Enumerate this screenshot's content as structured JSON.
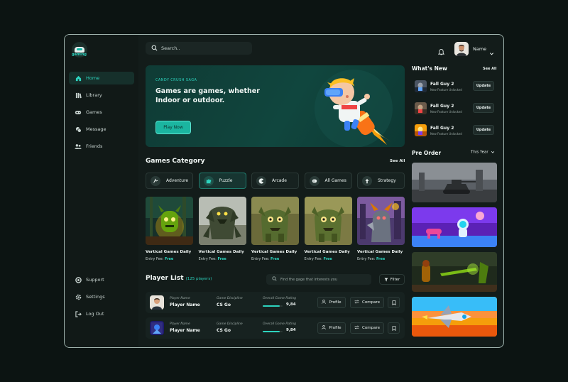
{
  "brand": {
    "name": "gaming"
  },
  "sidebar": {
    "items": [
      {
        "label": "Home",
        "icon": "home-icon",
        "active": true
      },
      {
        "label": "Library",
        "icon": "library-icon"
      },
      {
        "label": "Games",
        "icon": "gamepad-icon"
      },
      {
        "label": "Message",
        "icon": "message-icon"
      },
      {
        "label": "Friends",
        "icon": "friends-icon"
      }
    ],
    "bottom": [
      {
        "label": "Support",
        "icon": "support-icon"
      },
      {
        "label": "Settings",
        "icon": "gear-icon"
      },
      {
        "label": "Log Out",
        "icon": "logout-icon"
      }
    ]
  },
  "header": {
    "search_placeholder": "Search..",
    "user_name": "Name"
  },
  "hero": {
    "eyebrow": "CANDY CRUSH SAGA",
    "title": "Games are games, whether Indoor or outdoor.",
    "button": "Play Now"
  },
  "categories": {
    "title": "Games Category",
    "see_all": "See All",
    "items": [
      {
        "label": "Adventure",
        "icon": "adventure-icon"
      },
      {
        "label": "Puzzle",
        "icon": "puzzle-icon",
        "active": true
      },
      {
        "label": "Arcade",
        "icon": "arcade-icon"
      },
      {
        "label": "All Games",
        "icon": "all-games-icon"
      },
      {
        "label": "Strategy",
        "icon": "strategy-icon"
      }
    ]
  },
  "games": {
    "fee_label": "Entry Fee:",
    "fee_value": "Free",
    "items": [
      {
        "name": "Vertical Games Daily"
      },
      {
        "name": "Vertical Games Daily"
      },
      {
        "name": "Vertical Games Daily"
      },
      {
        "name": "Vertical Games Daily"
      },
      {
        "name": "Vertical Games Daily"
      }
    ]
  },
  "player_list": {
    "title": "Player List",
    "count": "(125 players)",
    "search_placeholder": "Find the gage that interests you",
    "filter": "Filter",
    "col_player": "Player Name",
    "col_discipline": "Game Discipline",
    "col_rating": "Overall Game Rating",
    "btn_profile": "Profile",
    "btn_compare": "Compare",
    "rows": [
      {
        "name": "Player Name",
        "discipline": "CS Go",
        "rating": "9,84",
        "rating_fraction": 0.85
      },
      {
        "name": "Player Name",
        "discipline": "CS Go",
        "rating": "9,84",
        "rating_fraction": 0.85
      }
    ]
  },
  "whats_new": {
    "title": "What's New",
    "see_all": "See All",
    "button": "Update",
    "items": [
      {
        "title": "Fall Guy 2",
        "sub": "New Feature Unlocked"
      },
      {
        "title": "Fall Guy 2",
        "sub": "New Feature Unlocked"
      },
      {
        "title": "Fall Guy 2",
        "sub": "New Feature Unlocked"
      }
    ]
  },
  "pre_order": {
    "title": "Pre Order",
    "filter": "This Year"
  }
}
